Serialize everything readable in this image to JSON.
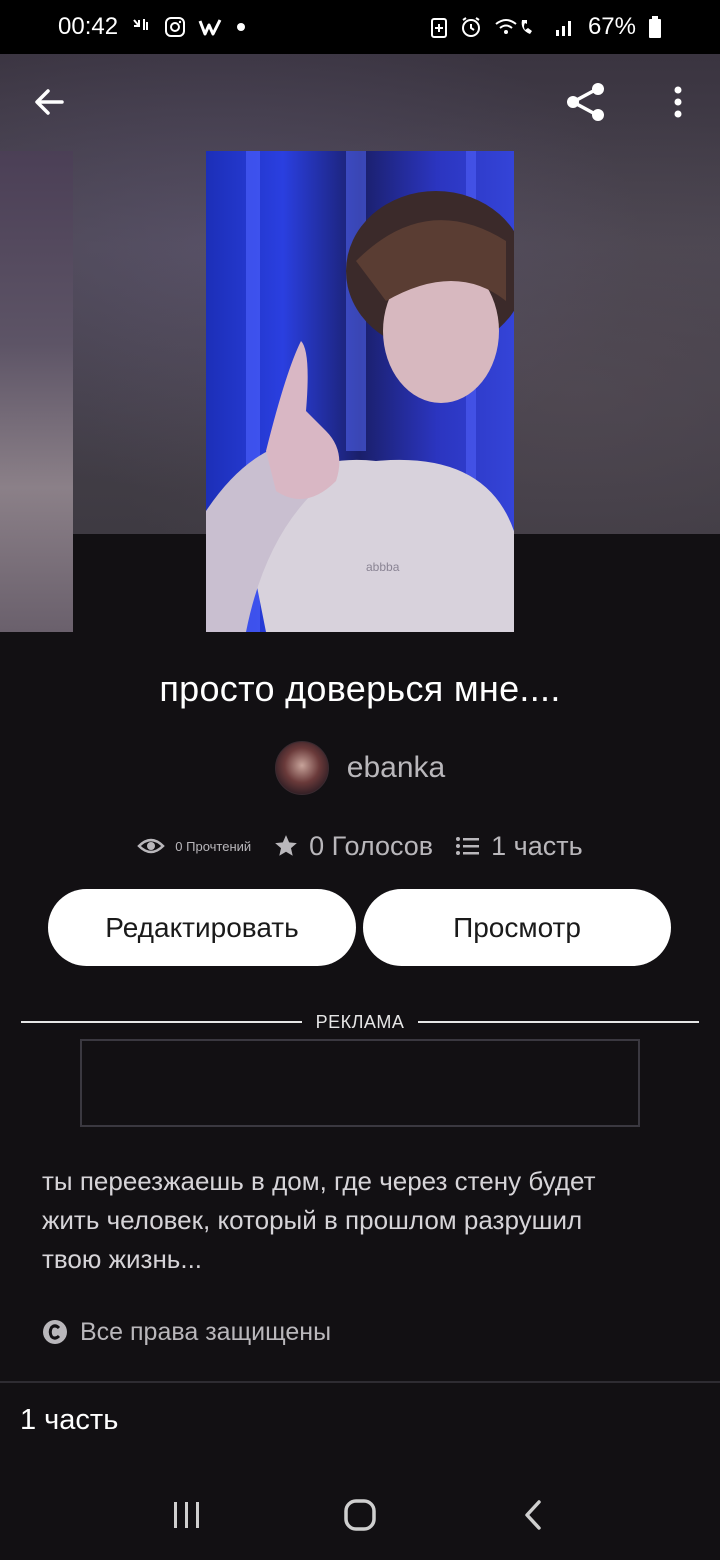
{
  "status_bar": {
    "time": "00:42",
    "battery": "67%",
    "icons": [
      "missed-call-icon",
      "instagram-icon",
      "wattpad-icon",
      "dot-icon",
      "battery-saver-icon",
      "alarm-icon",
      "wifi-call-icon",
      "signal-icon",
      "battery-icon"
    ]
  },
  "toolbar": {
    "back_icon": "arrow-left-icon",
    "share_icon": "share-icon",
    "more_icon": "more-vertical-icon"
  },
  "story": {
    "title": "просто доверься мне....",
    "author": "ebanka",
    "reads": "0 Прочтений",
    "votes": "0 Голосов",
    "parts": "1 часть",
    "description": "ты переезжаешь в дом, где через стену будет жить человек, который в прошлом разрушил твою жизнь...",
    "rights": "Все права защищены"
  },
  "actions": {
    "edit_label": "Редактировать",
    "view_label": "Просмотр"
  },
  "ad": {
    "label": "РЕКЛАМА"
  },
  "parts_section": {
    "heading": "1 часть"
  },
  "colors": {
    "background": "#121013",
    "button_bg": "#ffffff",
    "muted_text": "#b9b7bb"
  }
}
